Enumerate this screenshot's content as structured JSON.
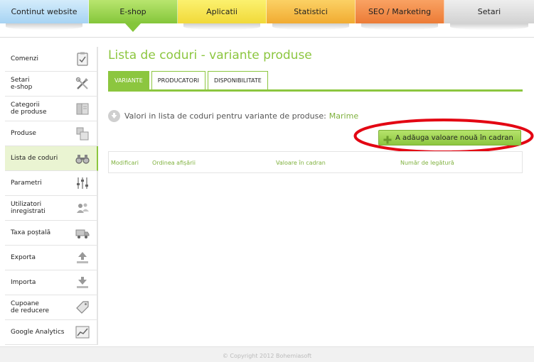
{
  "topnav": {
    "tabs": [
      {
        "label": "Continut website"
      },
      {
        "label": "E-shop"
      },
      {
        "label": "Aplicatii"
      },
      {
        "label": "Statistici"
      },
      {
        "label": "SEO / Marketing"
      },
      {
        "label": "Setari"
      }
    ],
    "active_tab": "E-shop"
  },
  "sidebar": {
    "items": [
      {
        "label": "Comenzi",
        "icon": "clipboard-icon"
      },
      {
        "label": "Setari\ne-shop",
        "icon": "tools-icon"
      },
      {
        "label": "Categorii\nde produse",
        "icon": "book-icon"
      },
      {
        "label": "Produse",
        "icon": "boxes-icon"
      },
      {
        "label": "Lista de coduri",
        "icon": "binoculars-icon"
      },
      {
        "label": "Parametri",
        "icon": "sliders-icon"
      },
      {
        "label": "Utilizatori\ninregistrati",
        "icon": "users-icon"
      },
      {
        "label": "Taxa poștală",
        "icon": "truck-icon"
      },
      {
        "label": "Exporta",
        "icon": "upload-icon"
      },
      {
        "label": "Importa",
        "icon": "download-icon"
      },
      {
        "label": "Cupoane\nde reducere",
        "icon": "tag-icon"
      },
      {
        "label": "Google Analytics",
        "icon": "chart-icon"
      }
    ],
    "active_item": "Lista de coduri"
  },
  "main": {
    "title": "Lista de coduri - variante produse",
    "tabs": [
      {
        "label": "VARIANTE"
      },
      {
        "label": "PRODUCATORI"
      },
      {
        "label": "DISPONIBILITATE"
      }
    ],
    "active_tab": "VARIANTE",
    "info_text": "Valori in lista de coduri pentru variante de produse:",
    "info_highlight": "Marime",
    "add_button_label": "A adăuga valoare nouă în cadran",
    "table": {
      "columns": [
        "Modificari",
        "Ordinea afișării",
        "Valoare în cadran",
        "Număr de legătură"
      ]
    }
  },
  "footer": {
    "copyright": "© Copyright 2012 Bohemiasoft"
  },
  "colors": {
    "accent_green": "#8cc63f",
    "highlight_red": "#e30613"
  }
}
